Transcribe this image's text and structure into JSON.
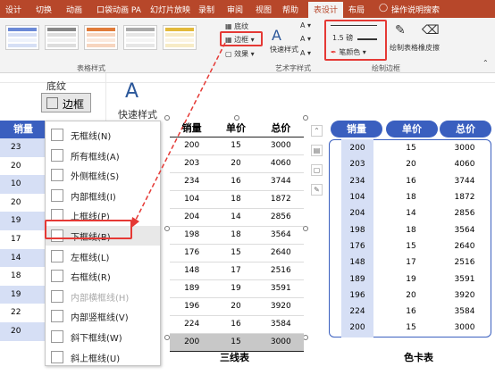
{
  "tabs": [
    "设计",
    "切换",
    "动画",
    "口袋动画 PA",
    "幻灯片放映",
    "录制",
    "审阅",
    "视图",
    "帮助",
    "表设计",
    "布局"
  ],
  "active_tab": "表设计",
  "tell_me": "操作说明搜索",
  "ribbon": {
    "table_styles_label": "表格样式",
    "border_label": "边框",
    "effects_label": "效果",
    "shading_label": "底纹",
    "quick_styles_label": "快速样式",
    "art_styles_label": "艺术字样式",
    "pen_weight": "1.5 磅",
    "pen_color_label": "笔颜色",
    "draw_table_label": "绘制表格",
    "eraser_label": "橡皮擦",
    "draw_borders_label": "绘制边框"
  },
  "canvas": {
    "shading_label": "底纹",
    "border_button_label": "边框",
    "quick_styles_label": "快速样式"
  },
  "border_menu": {
    "items": [
      {
        "label": "无框线(N)",
        "disabled": false
      },
      {
        "label": "所有框线(A)",
        "disabled": false
      },
      {
        "label": "外侧框线(S)",
        "disabled": false
      },
      {
        "label": "内部框线(I)",
        "disabled": false
      },
      {
        "label": "上框线(P)",
        "disabled": false
      },
      {
        "label": "下框线(B)",
        "disabled": false
      },
      {
        "label": "左框线(L)",
        "disabled": false
      },
      {
        "label": "右框线(R)",
        "disabled": false
      },
      {
        "label": "内部横框线(H)",
        "disabled": true
      },
      {
        "label": "内部竖框线(V)",
        "disabled": false
      },
      {
        "label": "斜下框线(W)",
        "disabled": false
      },
      {
        "label": "斜上框线(U)",
        "disabled": false
      }
    ],
    "highlighted": "下框线(B)"
  },
  "left_table": {
    "header": "销量",
    "rows": [
      "23",
      "20",
      "10",
      "20",
      "19",
      "17",
      "14",
      "18",
      "19",
      "22",
      "20"
    ]
  },
  "three_line_table": {
    "caption": "三线表",
    "headers": [
      "销量",
      "单价",
      "总价"
    ],
    "rows": [
      [
        "200",
        "15",
        "3000"
      ],
      [
        "203",
        "20",
        "4060"
      ],
      [
        "234",
        "16",
        "3744"
      ],
      [
        "104",
        "18",
        "1872"
      ],
      [
        "204",
        "14",
        "2856"
      ],
      [
        "198",
        "18",
        "3564"
      ],
      [
        "176",
        "15",
        "2640"
      ],
      [
        "148",
        "17",
        "2516"
      ],
      [
        "189",
        "19",
        "3591"
      ],
      [
        "196",
        "20",
        "3920"
      ],
      [
        "224",
        "16",
        "3584"
      ],
      [
        "200",
        "15",
        "3000"
      ]
    ]
  },
  "color_card_table": {
    "caption": "色卡表",
    "headers": [
      "销量",
      "单价",
      "总价"
    ],
    "rows": [
      [
        "200",
        "15",
        "3000"
      ],
      [
        "203",
        "20",
        "4060"
      ],
      [
        "234",
        "16",
        "3744"
      ],
      [
        "104",
        "18",
        "1872"
      ],
      [
        "204",
        "14",
        "2856"
      ],
      [
        "198",
        "18",
        "3564"
      ],
      [
        "176",
        "15",
        "2640"
      ],
      [
        "148",
        "17",
        "2516"
      ],
      [
        "189",
        "19",
        "3591"
      ],
      [
        "196",
        "20",
        "3920"
      ],
      [
        "224",
        "16",
        "3584"
      ],
      [
        "200",
        "15",
        "3000"
      ]
    ]
  },
  "colors": {
    "tab_bar": "#b7472a",
    "accent_blue": "#3a5fbf",
    "light_blue": "#d6dff5",
    "highlight_red": "#e53935",
    "gray_row": "#c8c8c8"
  }
}
